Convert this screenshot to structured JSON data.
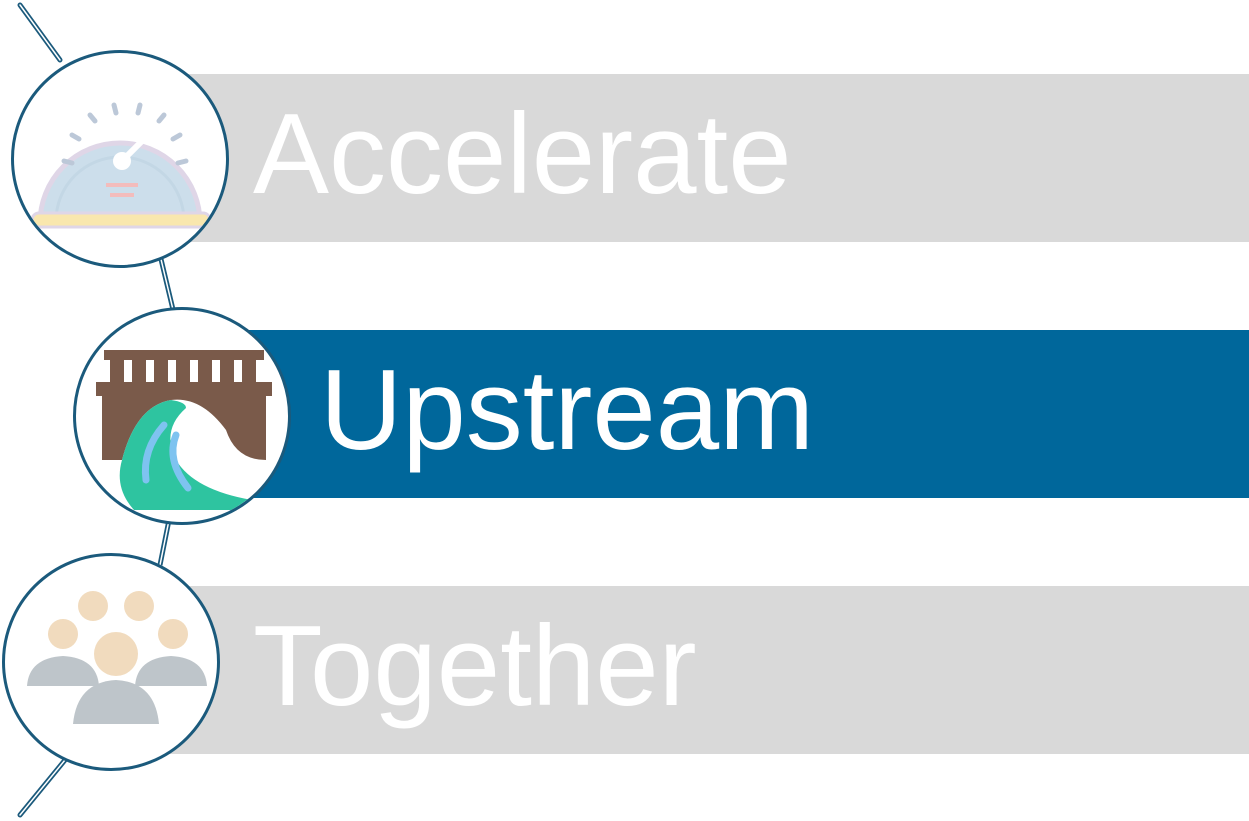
{
  "steps": [
    {
      "label": "Accelerate",
      "icon": "speedometer-icon",
      "state": "inactive"
    },
    {
      "label": "Upstream",
      "icon": "bridge-river-icon",
      "state": "active"
    },
    {
      "label": "Together",
      "icon": "group-people-icon",
      "state": "inactive"
    }
  ],
  "colors": {
    "active_band": "#00679b",
    "inactive_band": "#d9d9d9",
    "label_text": "#ffffff",
    "circle_border": "#1b5a7c"
  }
}
